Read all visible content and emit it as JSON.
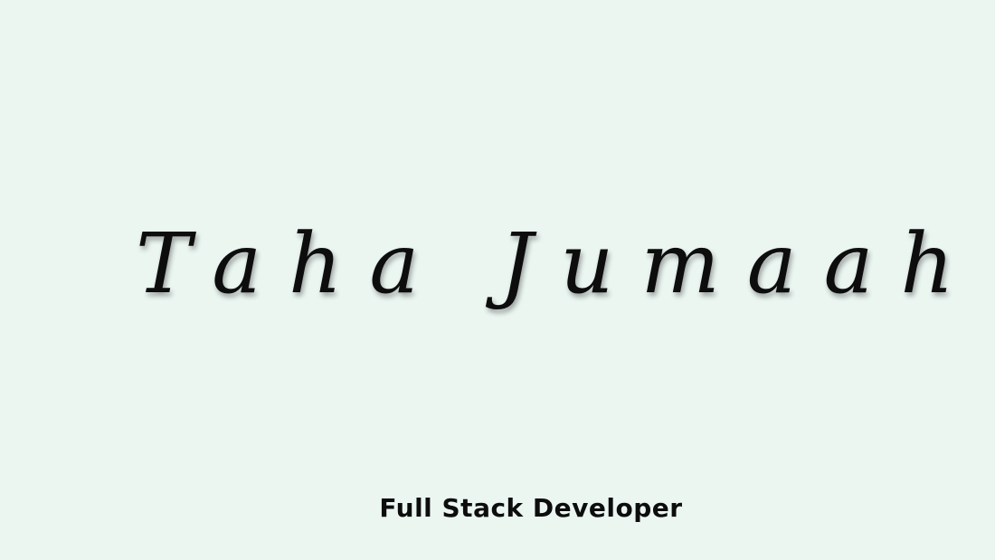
{
  "hero": {
    "name": "Taha Jumaah",
    "subtitle": "Full Stack Developer"
  },
  "colors": {
    "background": "#ebf6f1",
    "text": "#0b0b0b"
  }
}
